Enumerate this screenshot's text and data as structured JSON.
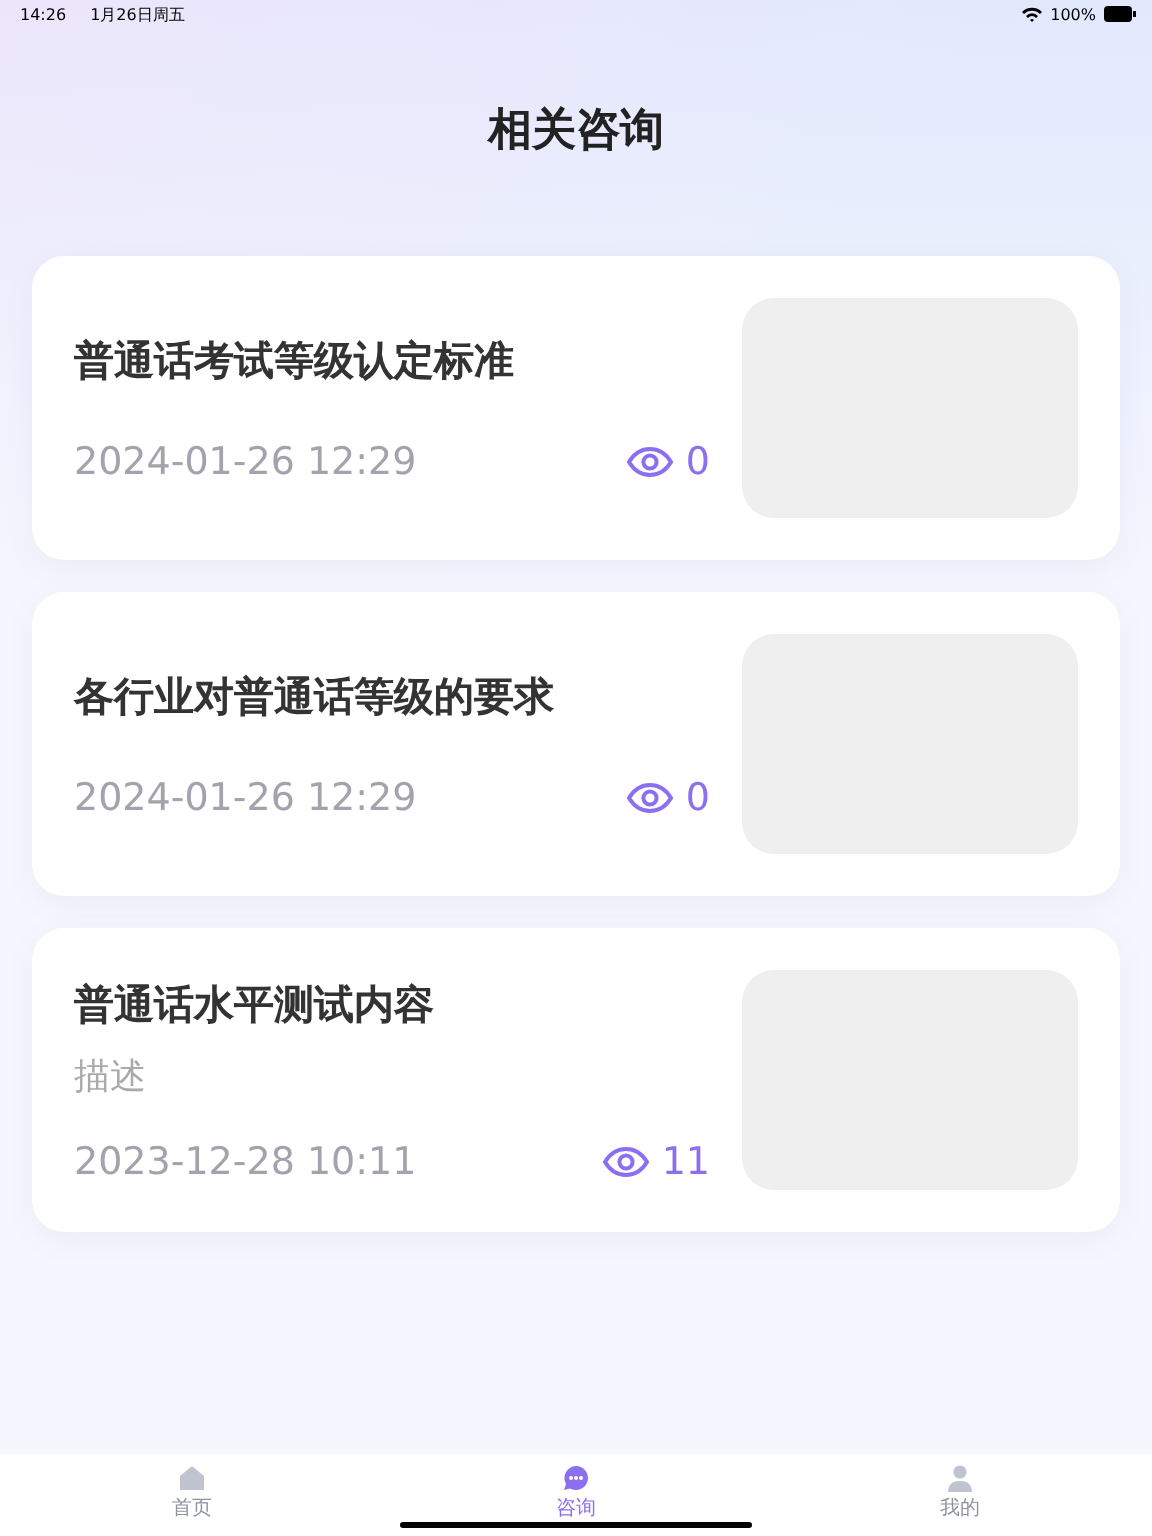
{
  "status_bar": {
    "time": "14:26",
    "date": "1月26日周五",
    "battery": "100%"
  },
  "title": "相关咨询",
  "articles": [
    {
      "title": "普通话考试等级认定标准",
      "date": "2024-01-26 12:29",
      "views": "0"
    },
    {
      "title": "各行业对普通话等级的要求",
      "date": "2024-01-26 12:29",
      "views": "0"
    },
    {
      "title": "普通话水平测试内容",
      "description": "描述",
      "date": "2023-12-28 10:11",
      "views": "11"
    }
  ],
  "tabs": [
    {
      "label": "首页",
      "kind": "home",
      "selected": false
    },
    {
      "label": "咨询",
      "kind": "chat",
      "selected": true
    },
    {
      "label": "我的",
      "kind": "user",
      "selected": false
    }
  ]
}
